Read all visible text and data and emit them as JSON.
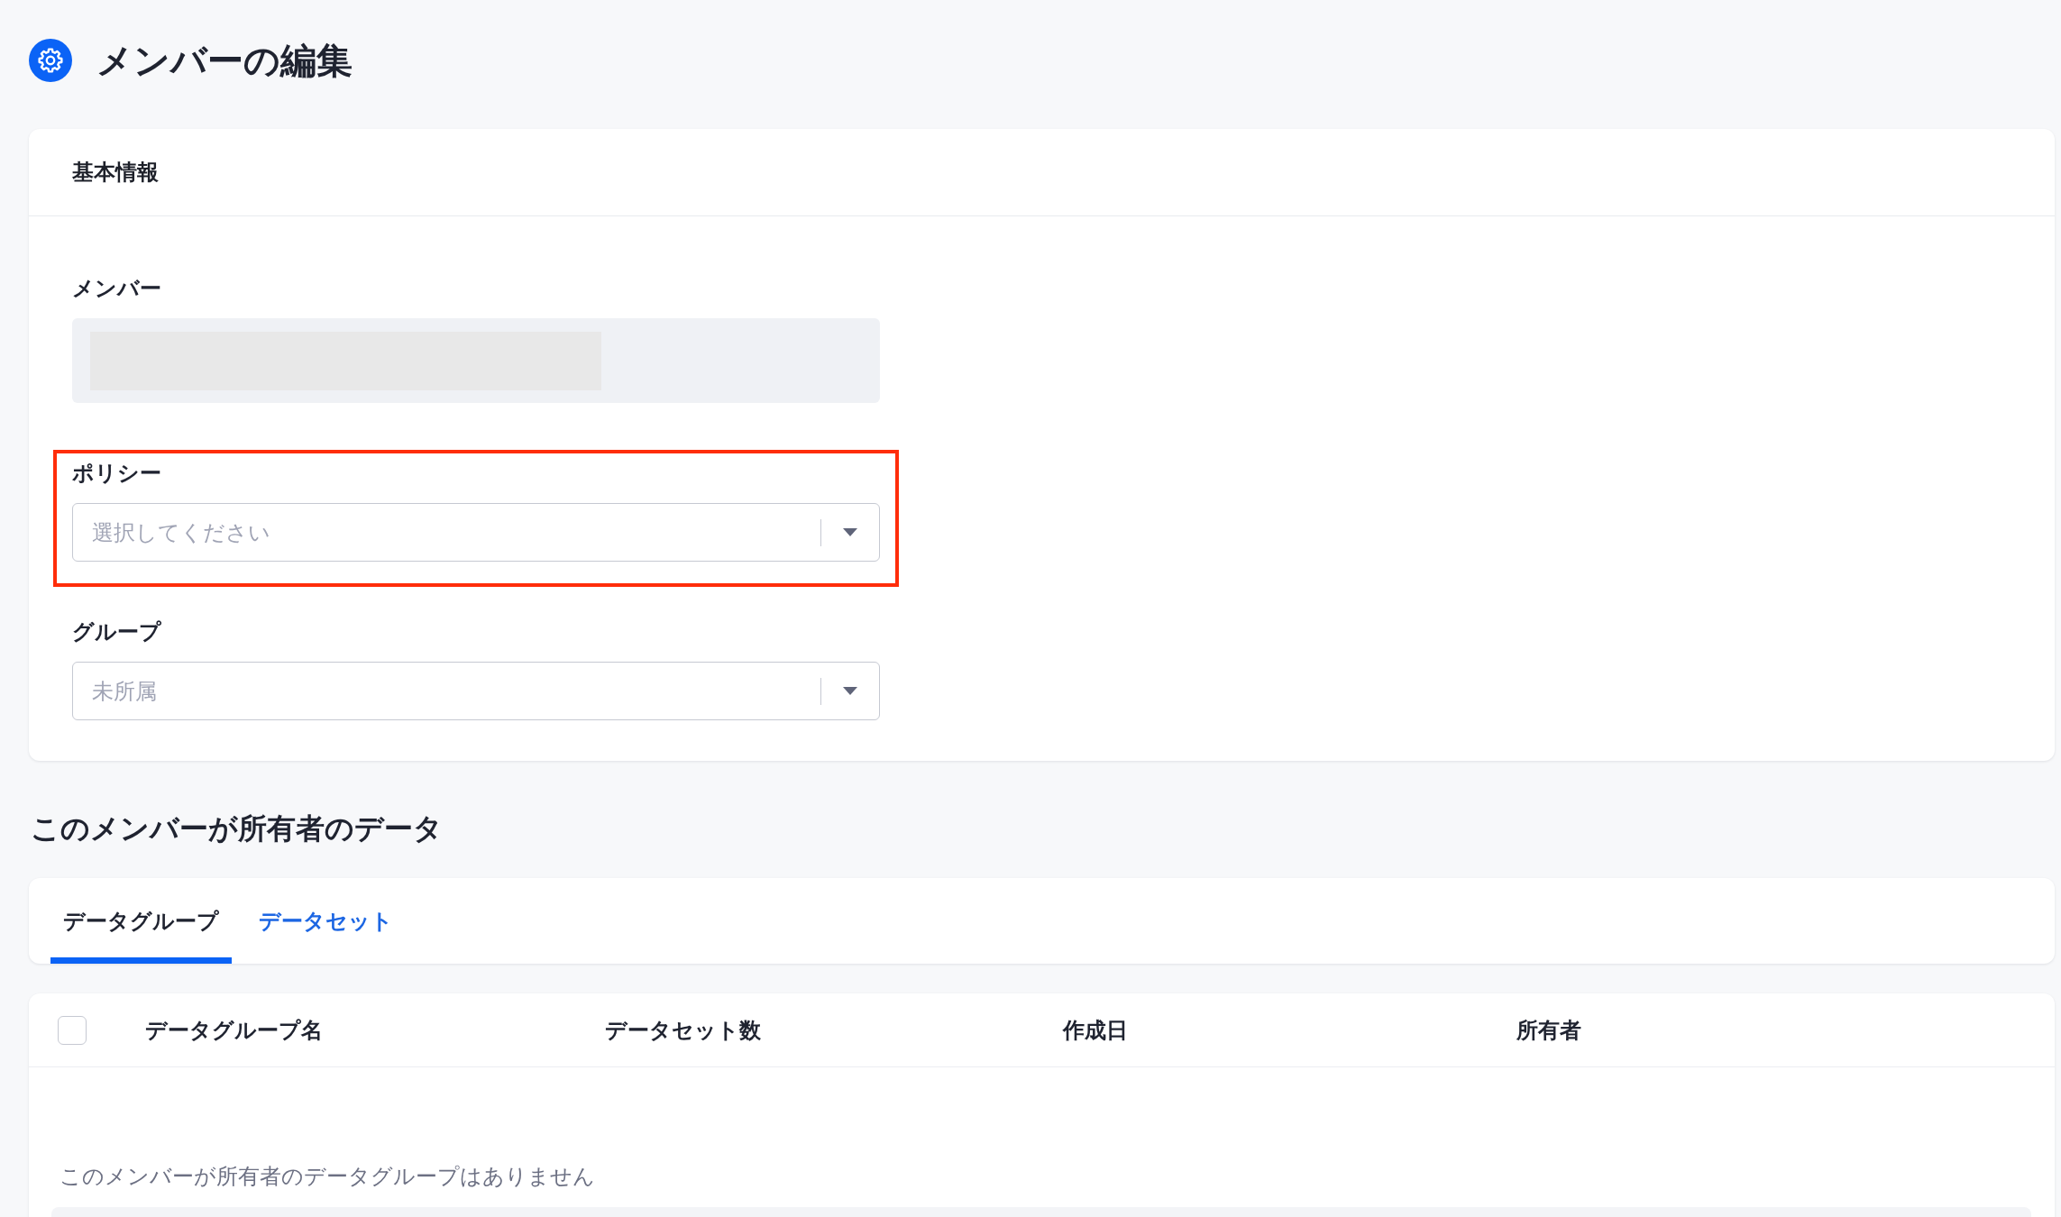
{
  "page": {
    "title": "メンバーの編集"
  },
  "basic_info": {
    "title": "基本情報",
    "fields": [
      {
        "kind": "readonly",
        "label": "メンバー",
        "redacted": true,
        "highlighted": false
      },
      {
        "kind": "select",
        "label": "ポリシー",
        "placeholder": "選択してください",
        "highlighted": true
      },
      {
        "kind": "select",
        "label": "グループ",
        "placeholder": "未所属",
        "highlighted": false
      }
    ]
  },
  "owned_data": {
    "title": "このメンバーが所有者のデータ",
    "tabs": [
      {
        "label": "データグループ",
        "selected": true
      },
      {
        "label": "データセット",
        "selected": false
      }
    ],
    "table": {
      "select_all_checked": false,
      "columns": [
        "データグループ名",
        "データセット数",
        "作成日",
        "所有者"
      ],
      "empty_message": "このメンバーが所有者のデータグループはありません"
    }
  }
}
